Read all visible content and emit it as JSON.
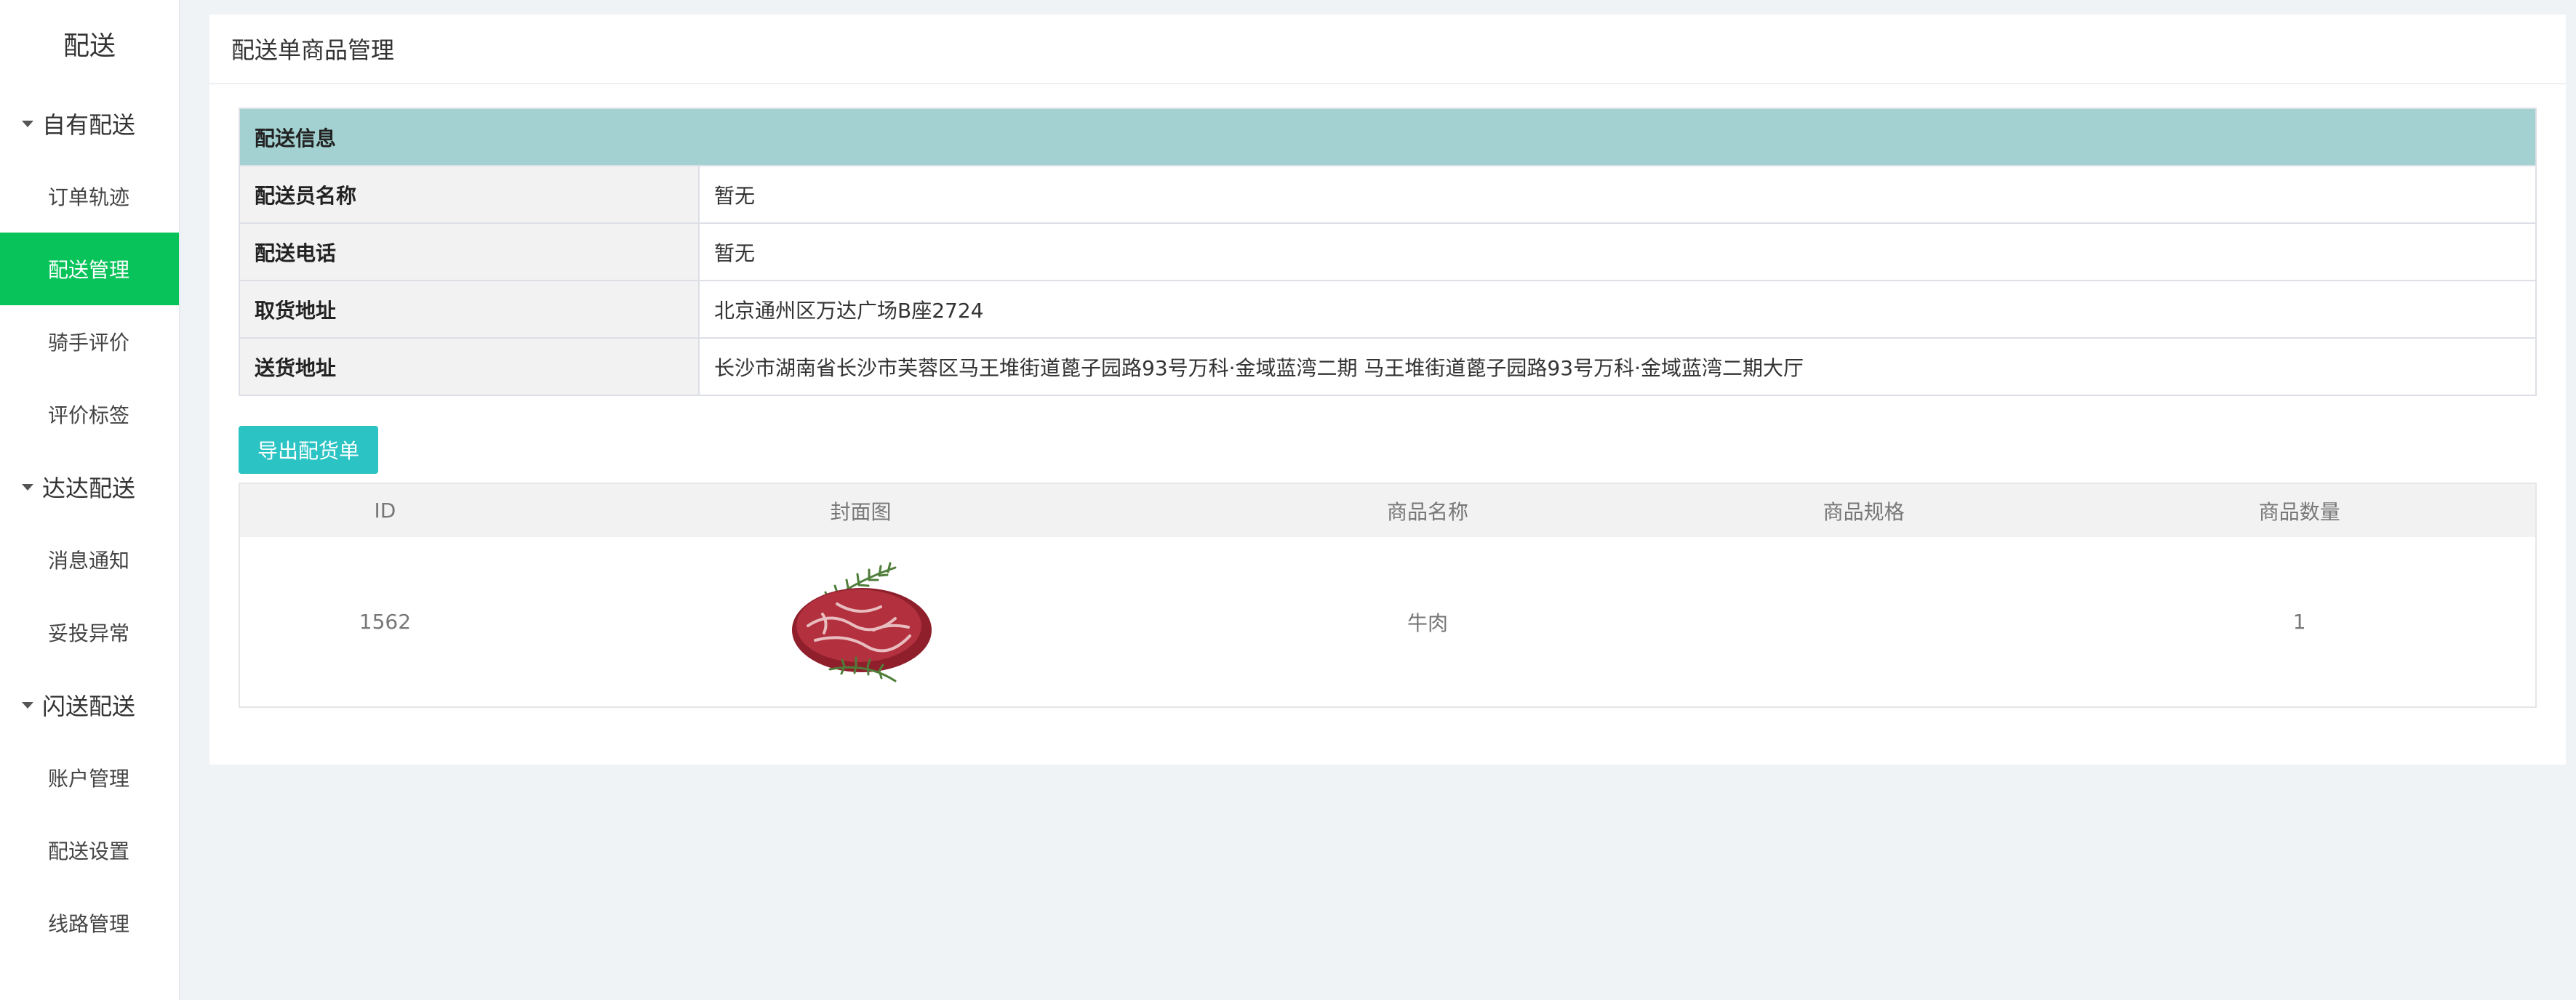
{
  "sidebar": {
    "brand": "配送",
    "groups": [
      {
        "title": "自有配送",
        "items": [
          "订单轨迹",
          "配送管理",
          "骑手评价",
          "评价标签"
        ]
      },
      {
        "title": "达达配送",
        "items": [
          "消息通知",
          "妥投异常"
        ]
      },
      {
        "title": "闪送配送",
        "items": [
          "账户管理",
          "配送设置",
          "线路管理"
        ]
      }
    ],
    "active_item": "配送管理",
    "active_color": "#08c35a"
  },
  "page": {
    "title": "配送单商品管理"
  },
  "info": {
    "section_title": "配送信息",
    "section_color": "#a3d1d1",
    "rows": [
      {
        "label": "配送员名称",
        "value": "暂无"
      },
      {
        "label": "配送电话",
        "value": "暂无"
      },
      {
        "label": "取货地址",
        "value": "北京通州区万达广场B座2724"
      },
      {
        "label": "送货地址",
        "value": "长沙市湖南省长沙市芙蓉区马王堆街道蓖子园路93号万科·金域蓝湾二期 马王堆街道蓖子园路93号万科·金域蓝湾二期大厅"
      }
    ]
  },
  "actions": {
    "export_label": "导出配货单",
    "export_color": "#2bc3c3"
  },
  "goods_table": {
    "headers": [
      "ID",
      "封面图",
      "商品名称",
      "商品规格",
      "商品数量"
    ],
    "rows": [
      {
        "id": "1562",
        "cover_icon": "raw-beef-steak-image",
        "name": "牛肉",
        "spec": "",
        "qty": "1"
      }
    ]
  }
}
